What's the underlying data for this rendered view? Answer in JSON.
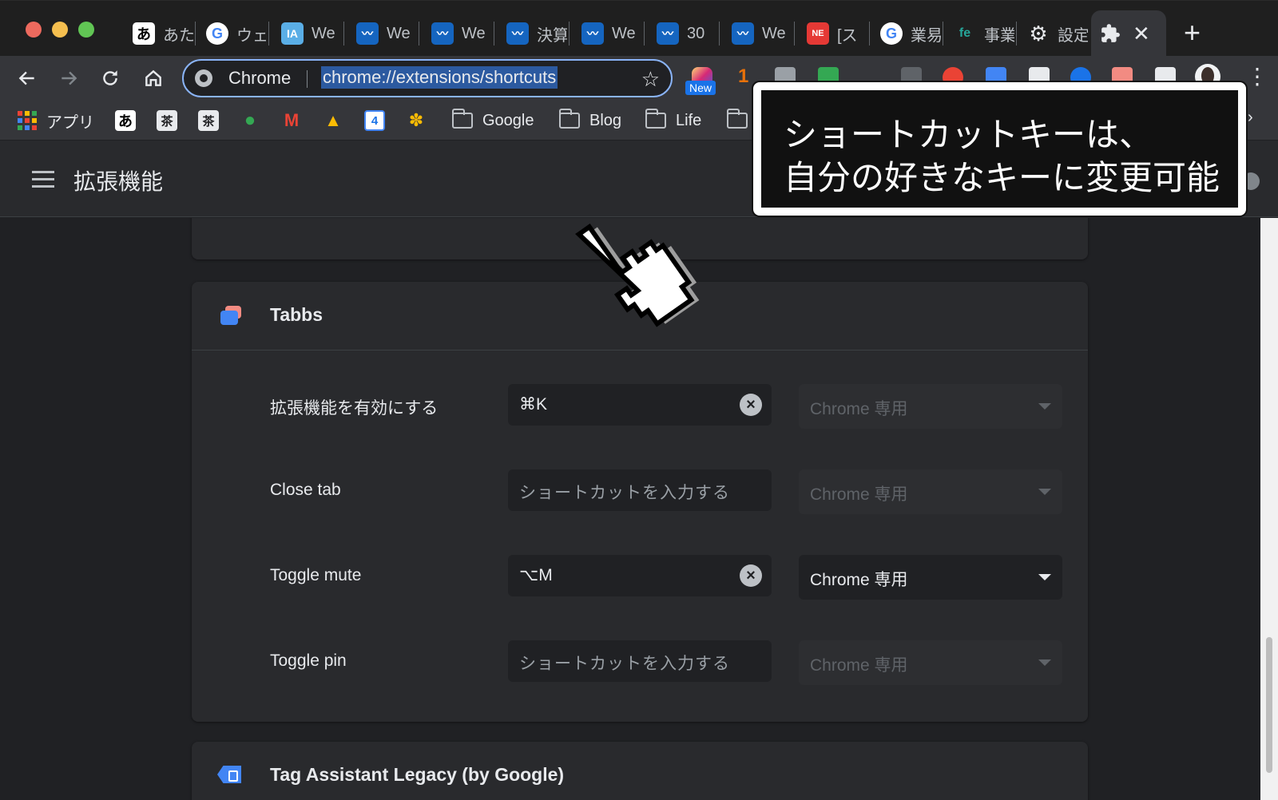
{
  "tabs": [
    {
      "label": "あた",
      "icon": "ata-icon",
      "color": "#ffffff"
    },
    {
      "label": "ウェ",
      "icon": "google-icon",
      "color": "#ffffff"
    },
    {
      "label": "We",
      "icon": "ia-icon",
      "color": "#5aaee6"
    },
    {
      "label": "We",
      "icon": "wave-icon",
      "color": "#1565c0"
    },
    {
      "label": "We",
      "icon": "wave-icon",
      "color": "#1565c0"
    },
    {
      "label": "決算",
      "icon": "wave-icon",
      "color": "#1565c0"
    },
    {
      "label": "We",
      "icon": "wave-icon",
      "color": "#1565c0"
    },
    {
      "label": "30",
      "icon": "wave-icon",
      "color": "#1565c0"
    },
    {
      "label": "We",
      "icon": "wave-icon",
      "color": "#1565c0"
    },
    {
      "label": "[ス",
      "icon": "next-icon",
      "color": "#e53935"
    },
    {
      "label": "業易",
      "icon": "google-icon",
      "color": "#ffffff"
    },
    {
      "label": "事業",
      "icon": "fe-icon",
      "color": "#26a69a"
    },
    {
      "label": "設定",
      "icon": "gear-icon",
      "color": "#e8eaed"
    },
    {
      "label": "",
      "icon": "puzzle-icon",
      "color": "#e8eaed",
      "active": true
    }
  ],
  "toolbar": {
    "omnibox_chip": "Chrome",
    "url": "chrome://extensions/shortcuts",
    "new_badge": "New",
    "badge_count": "1"
  },
  "bookmarks": [
    {
      "label": "アプリ",
      "icon": "apps-grid-icon"
    },
    {
      "label": "",
      "icon": "ata-icon"
    },
    {
      "label": "",
      "icon": "kanji-icon"
    },
    {
      "label": "",
      "icon": "kanji-icon"
    },
    {
      "label": "",
      "icon": "maps-icon"
    },
    {
      "label": "",
      "icon": "gmail-icon"
    },
    {
      "label": "",
      "icon": "drive-icon"
    },
    {
      "label": "",
      "icon": "calendar-icon"
    },
    {
      "label": "",
      "icon": "photos-icon"
    },
    {
      "label": "Google",
      "icon": "folder-icon"
    },
    {
      "label": "Blog",
      "icon": "folder-icon"
    },
    {
      "label": "Life",
      "icon": "folder-icon"
    },
    {
      "label": "",
      "icon": "folder-icon"
    }
  ],
  "calendar_day": "4",
  "page": {
    "title": "拡張機能"
  },
  "extension": {
    "name": "Tabbs",
    "shortcuts": [
      {
        "command": "拡張機能を有効にする",
        "value": "⌘K",
        "placeholder": "",
        "scope": "Chrome 専用",
        "enabled": false
      },
      {
        "command": "Close tab",
        "value": "",
        "placeholder": "ショートカットを入力する",
        "scope": "Chrome 専用",
        "enabled": false
      },
      {
        "command": "Toggle mute",
        "value": "⌥M",
        "placeholder": "",
        "scope": "Chrome 専用",
        "enabled": true
      },
      {
        "command": "Toggle pin",
        "value": "",
        "placeholder": "ショートカットを入力する",
        "scope": "Chrome 専用",
        "enabled": false
      }
    ]
  },
  "next_extension": {
    "name": "Tag Assistant Legacy (by Google)"
  },
  "annotation": {
    "line1": "ショートカットキーは、",
    "line2": "自分の好きなキーに変更可能"
  },
  "colors": {
    "accent": "#8ab4f8",
    "background": "#202124",
    "card": "#292a2d"
  }
}
